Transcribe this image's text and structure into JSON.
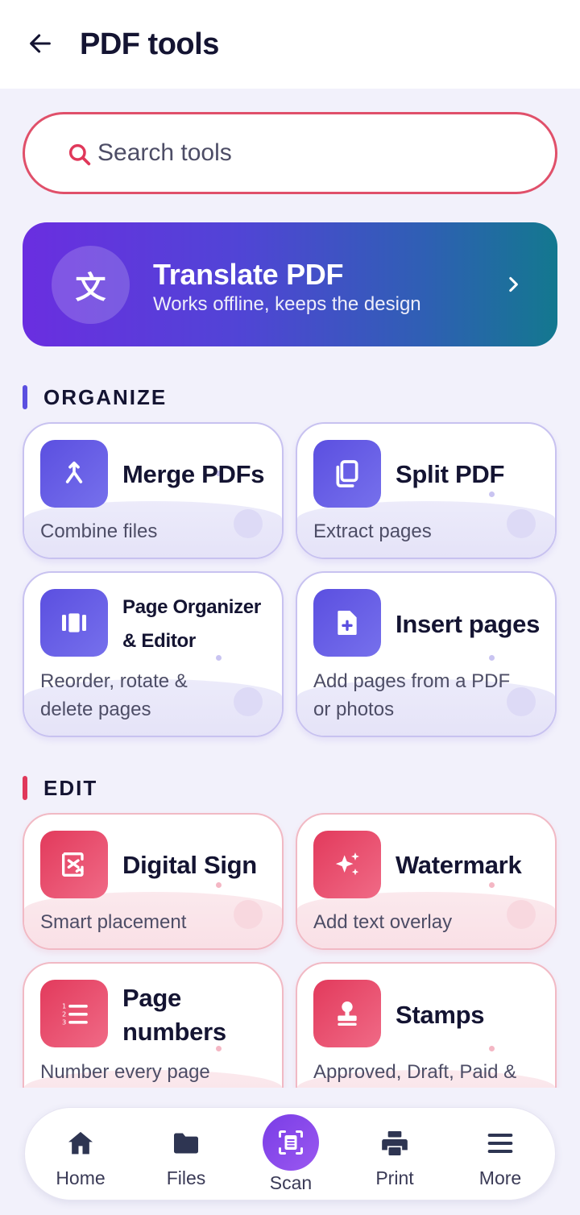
{
  "header": {
    "title": "PDF tools",
    "back_icon": "arrow-left-icon"
  },
  "search": {
    "placeholder": "Search tools",
    "value": "",
    "icon": "search-icon"
  },
  "banner": {
    "icon_glyph": "文",
    "icon": "translate-icon",
    "title": "Translate PDF",
    "subtitle": "Works offline, keeps the design",
    "chevron": "chevron-right-icon"
  },
  "sections": {
    "organize": {
      "title": "ORGANIZE",
      "accent": "#5b4fe0",
      "cards": [
        {
          "title": "Merge PDFs",
          "subtitle": "Combine files",
          "icon": "merge-icon"
        },
        {
          "title": "Split PDF",
          "subtitle": "Extract pages",
          "icon": "split-copy-icon"
        },
        {
          "title_line1": "Page Organizer",
          "title_line2": "& Editor",
          "subtitle_line1": "Reorder, rotate &",
          "subtitle_line2": "delete pages",
          "icon": "page-organizer-icon"
        },
        {
          "title": "Insert pages",
          "subtitle_line1": "Add pages from a PDF",
          "subtitle_line2": "or photos",
          "icon": "insert-page-icon"
        }
      ]
    },
    "edit": {
      "title": "EDIT",
      "accent": "#e0385a",
      "cards": [
        {
          "title": "Digital Sign",
          "subtitle": "Smart placement",
          "icon": "signature-icon"
        },
        {
          "title": "Watermark",
          "subtitle": "Add text overlay",
          "icon": "sparkle-icon"
        },
        {
          "title_line1": "Page",
          "title_line2": "numbers",
          "subtitle": "Number every page",
          "icon": "numbered-list-icon"
        },
        {
          "title": "Stamps",
          "subtitle": "Approved, Draft, Paid &",
          "icon": "stamp-icon"
        }
      ]
    }
  },
  "nav": {
    "items": [
      {
        "label": "Home",
        "icon": "home-icon"
      },
      {
        "label": "Files",
        "icon": "folder-icon"
      },
      {
        "label": "Scan",
        "icon": "scan-document-icon"
      },
      {
        "label": "Print",
        "icon": "printer-icon"
      },
      {
        "label": "More",
        "icon": "menu-icon"
      }
    ]
  },
  "colors": {
    "background": "#f2f1fb",
    "violet_accent": "#5b4fe0",
    "red_accent": "#e0385a",
    "scan_accent": "#8a4aeb",
    "text_dark": "#141432"
  }
}
